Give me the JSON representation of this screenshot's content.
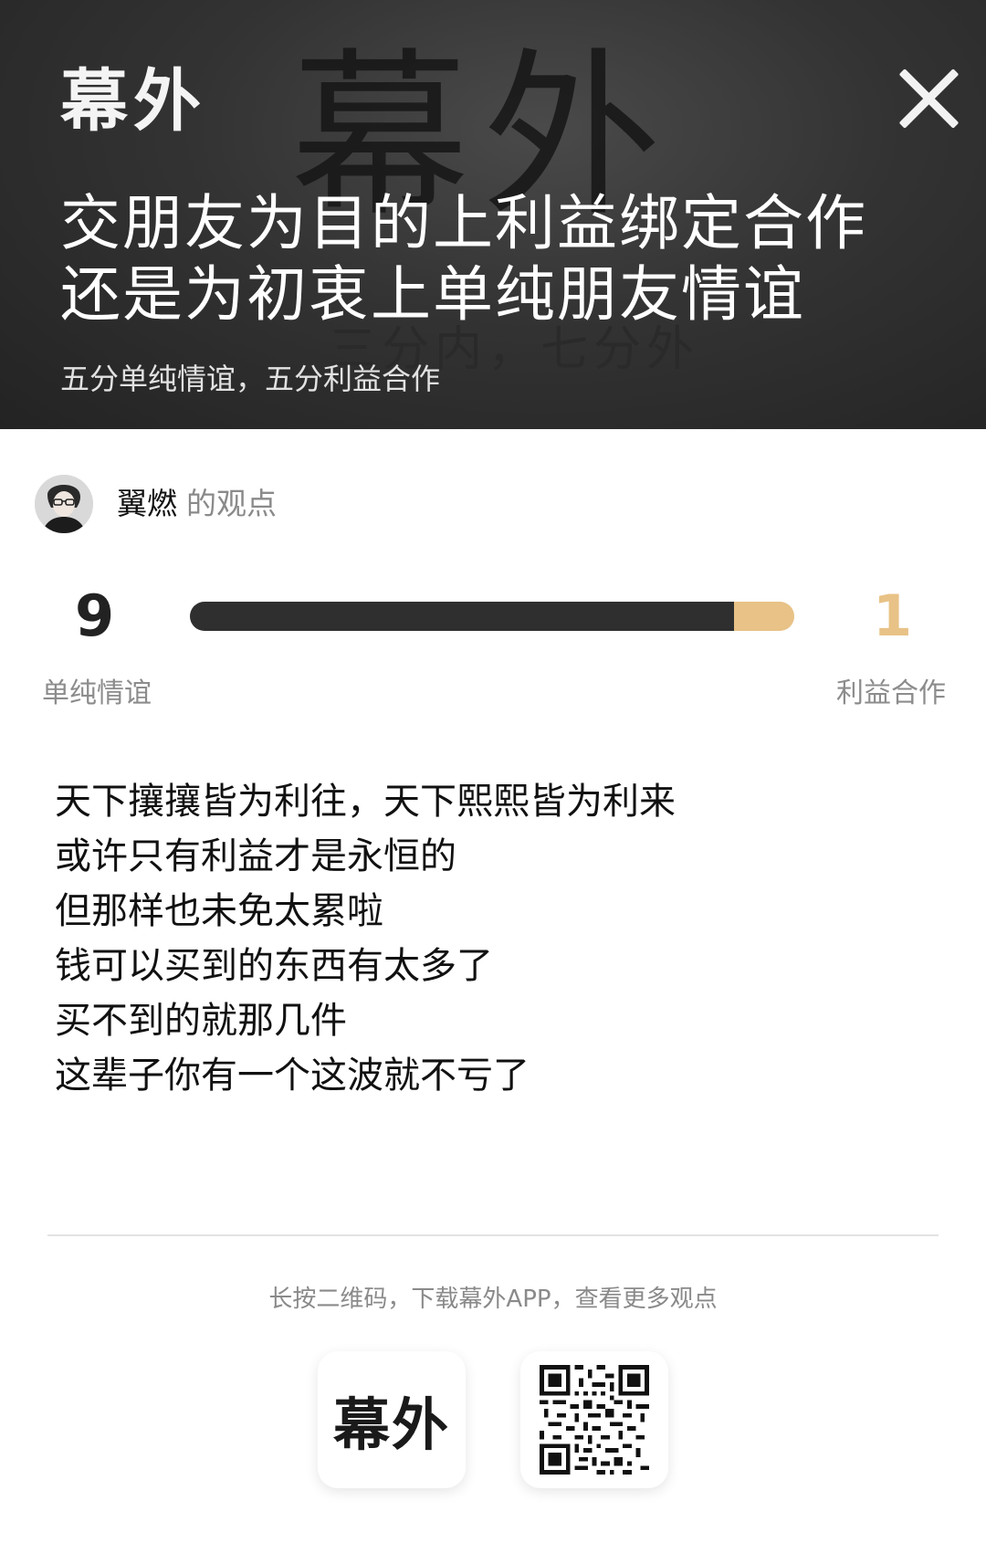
{
  "header": {
    "logo": "幕外",
    "watermark": "幕外",
    "watermark_sub": "三分内，七分外",
    "title": "交朋友为目的上利益绑定合作还是为初衷上单纯朋友情谊",
    "subtitle": "五分单纯情谊，五分利益合作"
  },
  "author": {
    "name": "翼燃",
    "suffix": "的观点"
  },
  "vote": {
    "left_count": "9",
    "right_count": "1",
    "left_label": "单纯情谊",
    "right_label": "利益合作",
    "left_fraction": 0.9,
    "left_color": "#2f2f2f",
    "right_color": "#e8c286"
  },
  "content": {
    "lines": [
      "天下攘攘皆为利往，天下熙熙皆为利来",
      "或许只有利益才是永恒的",
      "但那样也未免太累啦",
      "钱可以买到的东西有太多了",
      "买不到的就那几件",
      "这辈子你有一个这波就不亏了"
    ]
  },
  "footer": {
    "hint": "长按二维码，下载幕外APP，查看更多观点",
    "app_logo": "幕外",
    "qr_icon": "qr-code-icon"
  }
}
